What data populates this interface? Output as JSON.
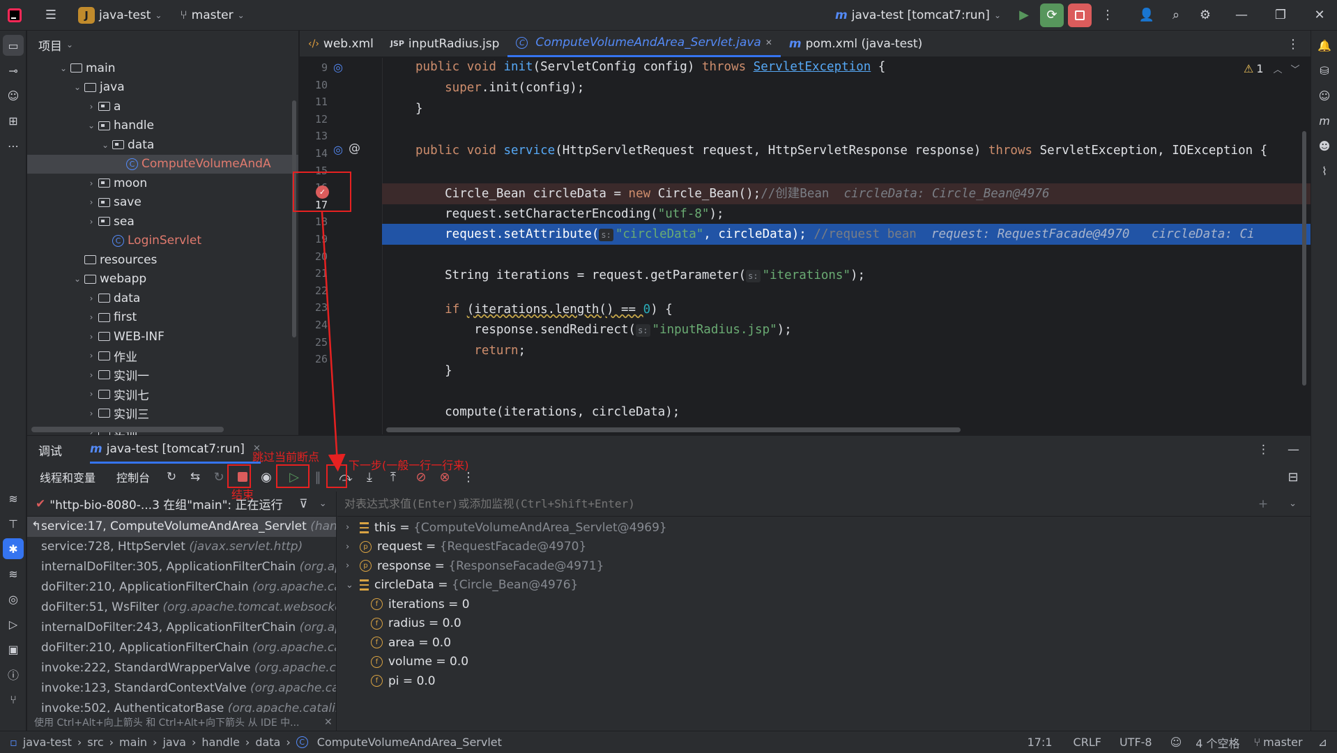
{
  "titlebar": {
    "project_letter": "J",
    "project_name": "java-test",
    "branch": "master",
    "run_config": "java-test [tomcat7:run]"
  },
  "project_panel": {
    "title": "项目",
    "tree": [
      {
        "label": "main",
        "indent": 0,
        "arrow": "open",
        "icon": "folder"
      },
      {
        "label": "java",
        "indent": 1,
        "arrow": "open",
        "icon": "folder"
      },
      {
        "label": "a",
        "indent": 2,
        "arrow": "closed",
        "icon": "pkg"
      },
      {
        "label": "handle",
        "indent": 2,
        "arrow": "open",
        "icon": "pkg"
      },
      {
        "label": "data",
        "indent": 3,
        "arrow": "open",
        "icon": "pkg"
      },
      {
        "label": "ComputeVolumeAndA",
        "indent": 4,
        "arrow": "none",
        "icon": "class",
        "selected": true
      },
      {
        "label": "moon",
        "indent": 2,
        "arrow": "closed",
        "icon": "pkg"
      },
      {
        "label": "save",
        "indent": 2,
        "arrow": "closed",
        "icon": "pkg"
      },
      {
        "label": "sea",
        "indent": 2,
        "arrow": "closed",
        "icon": "pkg"
      },
      {
        "label": "LoginServlet",
        "indent": 3,
        "arrow": "none",
        "icon": "class"
      },
      {
        "label": "resources",
        "indent": 1,
        "arrow": "none",
        "icon": "folder"
      },
      {
        "label": "webapp",
        "indent": 1,
        "arrow": "open",
        "icon": "folder"
      },
      {
        "label": "data",
        "indent": 2,
        "arrow": "closed",
        "icon": "folder"
      },
      {
        "label": "first",
        "indent": 2,
        "arrow": "closed",
        "icon": "folder"
      },
      {
        "label": "WEB-INF",
        "indent": 2,
        "arrow": "closed",
        "icon": "folder"
      },
      {
        "label": "作业",
        "indent": 2,
        "arrow": "closed",
        "icon": "folder"
      },
      {
        "label": "实训一",
        "indent": 2,
        "arrow": "closed",
        "icon": "folder"
      },
      {
        "label": "实训七",
        "indent": 2,
        "arrow": "closed",
        "icon": "folder"
      },
      {
        "label": "实训三",
        "indent": 2,
        "arrow": "closed",
        "icon": "folder"
      },
      {
        "label": "实训二",
        "indent": 2,
        "arrow": "closed",
        "icon": "folder"
      }
    ]
  },
  "tabs": [
    {
      "label": "web.xml",
      "icon": "xml"
    },
    {
      "label": "inputRadius.jsp",
      "icon": "jsp"
    },
    {
      "label": "ComputeVolumeAndArea_Servlet.java",
      "icon": "class",
      "active": true
    },
    {
      "label": "pom.xml (java-test)",
      "icon": "maven"
    }
  ],
  "editor": {
    "warning_count": "1",
    "lines": [
      "9",
      "10",
      "11",
      "12",
      "13",
      "14",
      "15",
      "16",
      "17",
      "18",
      "19",
      "20",
      "21",
      "22",
      "23",
      "24",
      "25",
      "26"
    ],
    "code": {
      "l9_a": "public void ",
      "l9_b": "init",
      "l9_c": "(ServletConfig config) ",
      "l9_d": "throws ",
      "l9_e": "ServletException",
      "l9_f": " {",
      "l10_a": "    super",
      "l10_b": ".init(config);",
      "l11": "}",
      "l13_a": "public void ",
      "l13_b": "service",
      "l13_c": "(HttpServletRequest request, HttpServletResponse response) ",
      "l13_d": "throws ",
      "l13_e": "ServletException, IOException {",
      "l15_a": "    Circle_Bean circleData = ",
      "l15_b": "new ",
      "l15_c": "Circle_Bean();",
      "l15_d": "//创建Bean",
      "l15_e": "circleData: Circle_Bean@4976",
      "l16_a": "    request.setCharacterEncoding(",
      "l16_b": "\"utf-8\"",
      "l16_c": ");",
      "l17_a": "    request.setAttribute(",
      "l17_hint": "s:",
      "l17_b": "\"circleData\"",
      "l17_c": ", circleData); ",
      "l17_d": "//request bean",
      "l17_e": "request: RequestFacade@4970",
      "l17_f": "circleData: Ci",
      "l19_a": "    String iterations = request.getParameter(",
      "l19_hint": "s:",
      "l19_b": "\"iterations\"",
      "l19_c": ");",
      "l21_a": "    ",
      "l21_b": "if ",
      "l21_c": "(iterations.length() == ",
      "l21_d": "0",
      "l21_e": ") {",
      "l22_a": "        response.sendRedirect(",
      "l22_hint": "s:",
      "l22_b": "\"inputRadius.jsp\"",
      "l22_c": ");",
      "l23_a": "        ",
      "l23_b": "return",
      "l23_c": ";",
      "l24": "    }",
      "l26": "    compute(iterations, circleData);"
    }
  },
  "debug": {
    "tab_debug": "调试",
    "session": "java-test [tomcat7:run]",
    "tab_threads": "线程和变量",
    "tab_console": "控制台",
    "thread": "\"http-bio-8080-...3 在组\"main\": 正在运行",
    "eval_placeholder": "对表达式求值(Enter)或添加监视(Ctrl+Shift+Enter)",
    "frames": [
      {
        "method": "service:17, ComputeVolumeAndArea_Servlet",
        "pkg": "(hand",
        "current": true
      },
      {
        "method": "service:728, HttpServlet",
        "pkg": "(javax.servlet.http)"
      },
      {
        "method": "internalDoFilter:305, ApplicationFilterChain",
        "pkg": "(org.ap"
      },
      {
        "method": "doFilter:210, ApplicationFilterChain",
        "pkg": "(org.apache.ca"
      },
      {
        "method": "doFilter:51, WsFilter",
        "pkg": "(org.apache.tomcat.websocke"
      },
      {
        "method": "internalDoFilter:243, ApplicationFilterChain",
        "pkg": "(org.ap"
      },
      {
        "method": "doFilter:210, ApplicationFilterChain",
        "pkg": "(org.apache.ca"
      },
      {
        "method": "invoke:222, StandardWrapperValve",
        "pkg": "(org.apache.ca"
      },
      {
        "method": "invoke:123, StandardContextValve",
        "pkg": "(org.apache.cat"
      },
      {
        "method": "invoke:502, AuthenticatorBase",
        "pkg": "(org.apache.catalin"
      }
    ],
    "hint_text": "使用 Ctrl+Alt+向上箭头 和 Ctrl+Alt+向下箭头 从 IDE 中...",
    "vars": [
      {
        "name": "this",
        "value": "{ComputeVolumeAndArea_Servlet@4969}",
        "icon": "stack",
        "arrow": "closed",
        "indent": 0
      },
      {
        "name": "request",
        "value": "{RequestFacade@4970}",
        "icon": "p",
        "arrow": "closed",
        "indent": 0
      },
      {
        "name": "response",
        "value": "{ResponseFacade@4971}",
        "icon": "p",
        "arrow": "closed",
        "indent": 0
      },
      {
        "name": "circleData",
        "value": "{Circle_Bean@4976}",
        "icon": "stack",
        "arrow": "open",
        "indent": 0
      },
      {
        "name": "iterations",
        "value": "0",
        "icon": "f",
        "arrow": "none",
        "indent": 1
      },
      {
        "name": "radius",
        "value": "0.0",
        "icon": "f",
        "arrow": "none",
        "indent": 1
      },
      {
        "name": "area",
        "value": "0.0",
        "icon": "f",
        "arrow": "none",
        "indent": 1
      },
      {
        "name": "volume",
        "value": "0.0",
        "icon": "f",
        "arrow": "none",
        "indent": 1
      },
      {
        "name": "pi",
        "value": "0.0",
        "icon": "f",
        "arrow": "none",
        "indent": 1
      }
    ]
  },
  "annotations": {
    "skip_breakpoint": "跳过当前断点",
    "next_step": "下一步(一般一行一行来)",
    "end": "结束"
  },
  "statusbar": {
    "crumbs": [
      "java-test",
      "src",
      "main",
      "java",
      "handle",
      "data",
      "ComputeVolumeAndArea_Servlet"
    ],
    "position": "17:1",
    "line_sep": "CRLF",
    "encoding": "UTF-8",
    "indent": "4 个空格",
    "branch": "master"
  },
  "colors": {
    "accent": "#3574f0",
    "annotation": "#e62121",
    "breakpoint": "#db5c5c",
    "exec_line": "#2154a6"
  }
}
